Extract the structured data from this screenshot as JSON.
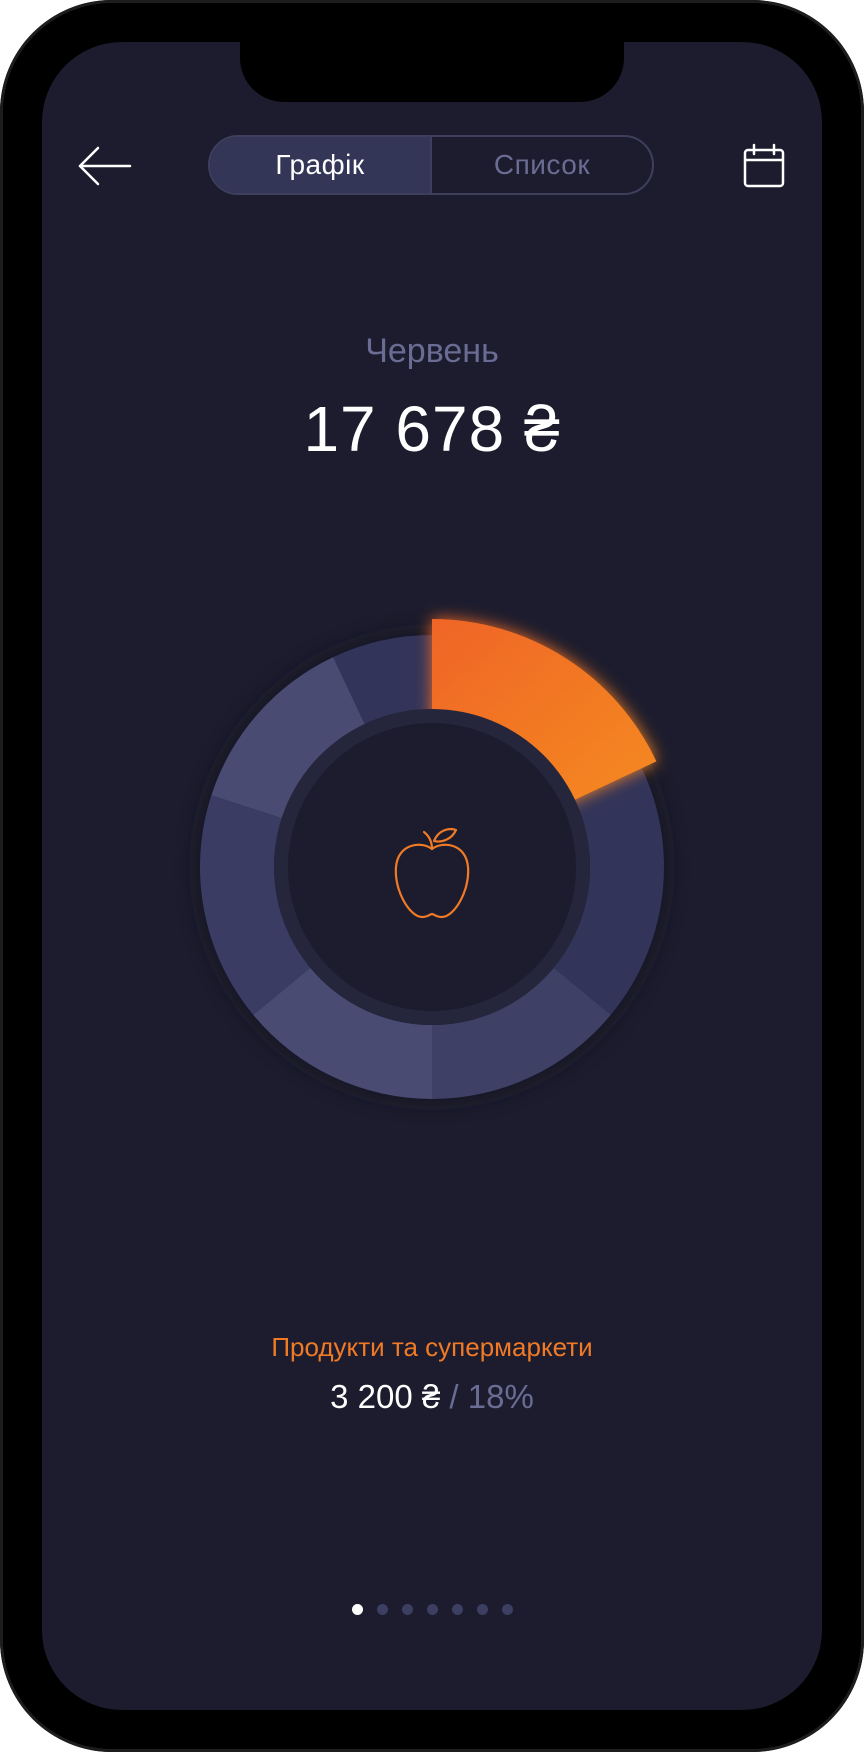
{
  "header": {
    "tabs": [
      {
        "label": "Графік",
        "active": true
      },
      {
        "label": "Список",
        "active": false
      }
    ]
  },
  "summary": {
    "month": "Червень",
    "total": "17 678 ₴"
  },
  "chart_data": {
    "type": "pie",
    "style": "donut",
    "highlight_color": "#f07a25",
    "categories": [
      "Продукти та супермаркети",
      "",
      "",
      "",
      "",
      "",
      ""
    ],
    "values": [
      18,
      18,
      14,
      14,
      16,
      13,
      7
    ],
    "center_icon": "apple-icon"
  },
  "selected_category": {
    "name": "Продукти та супермаркети",
    "amount": "3 200 ₴",
    "separator": " / ",
    "percent": "18%"
  },
  "pagination": {
    "count": 7,
    "active_index": 0
  },
  "icons": {
    "back": "arrow-left-icon",
    "calendar": "calendar-icon",
    "center": "apple-icon"
  }
}
